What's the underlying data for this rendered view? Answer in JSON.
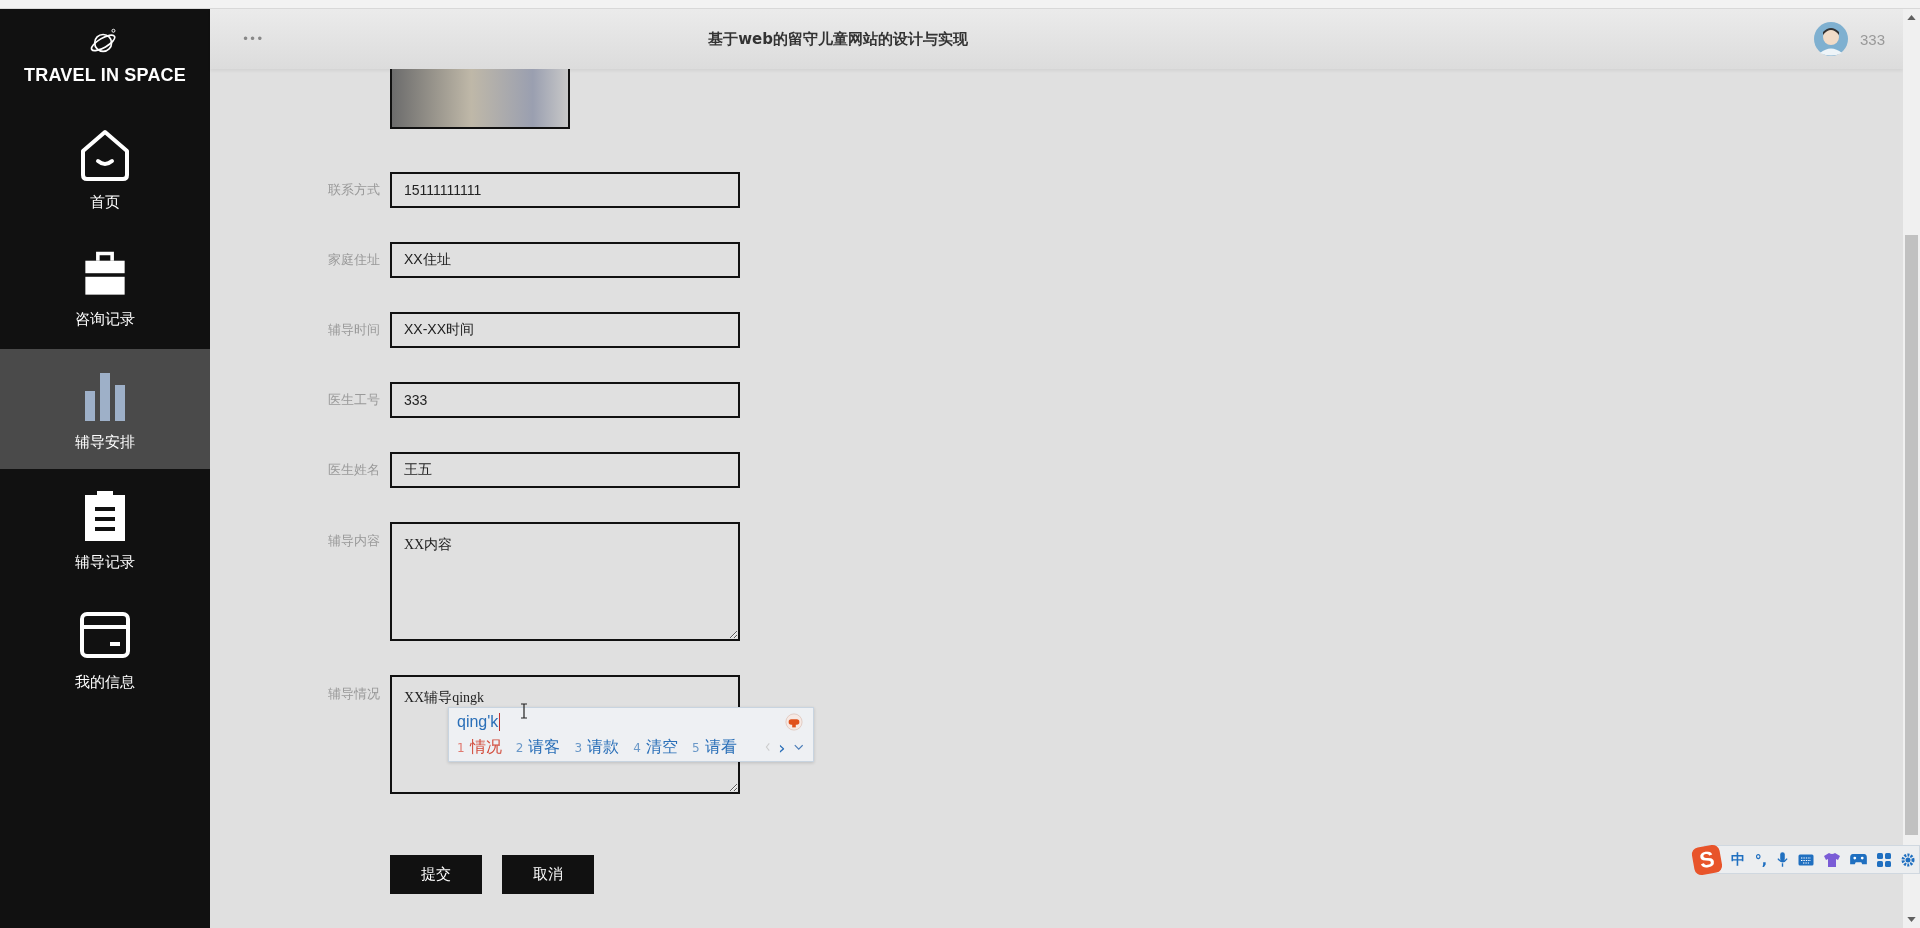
{
  "sidebar": {
    "logo": "TRAVEL IN SPACE",
    "items": [
      {
        "kind": "home",
        "label": "首页",
        "selected": false
      },
      {
        "kind": "briefcase",
        "label": "咨询记录",
        "selected": false
      },
      {
        "kind": "chart",
        "label": "辅导安排",
        "selected": true
      },
      {
        "kind": "clipboard",
        "label": "辅导记录",
        "selected": false
      },
      {
        "kind": "card",
        "label": "我的信息",
        "selected": false
      }
    ]
  },
  "header": {
    "menu": "•••",
    "title": "基于web的留守儿童网站的设计与实现",
    "user": "333"
  },
  "form": {
    "fields": [
      {
        "kind": "input",
        "label": "联系方式",
        "value": "15111111111"
      },
      {
        "kind": "input",
        "label": "家庭住址",
        "value": "XX住址"
      },
      {
        "kind": "input",
        "label": "辅导时间",
        "value": "XX-XX时间"
      },
      {
        "kind": "input",
        "label": "医生工号",
        "value": "333"
      },
      {
        "kind": "input",
        "label": "医生姓名",
        "value": "王五"
      },
      {
        "kind": "textarea",
        "label": "辅导内容",
        "value": "XX内容"
      },
      {
        "kind": "textarea",
        "label": "辅导情况",
        "value": "XX辅导qingk"
      }
    ],
    "buttons": [
      "提交",
      "取消"
    ]
  },
  "ime": {
    "composition": "qing'k",
    "candidates": [
      {
        "number": "1",
        "text": "情况",
        "selected": true
      },
      {
        "number": "2",
        "text": "请客",
        "selected": false
      },
      {
        "number": "3",
        "text": "请款",
        "selected": false
      },
      {
        "number": "4",
        "text": "清空",
        "selected": false
      },
      {
        "number": "5",
        "text": "请看",
        "selected": false
      }
    ],
    "next": "›"
  },
  "ime_toolbar": {
    "logo": "S",
    "mode": "中",
    "punctuation": "°,"
  }
}
